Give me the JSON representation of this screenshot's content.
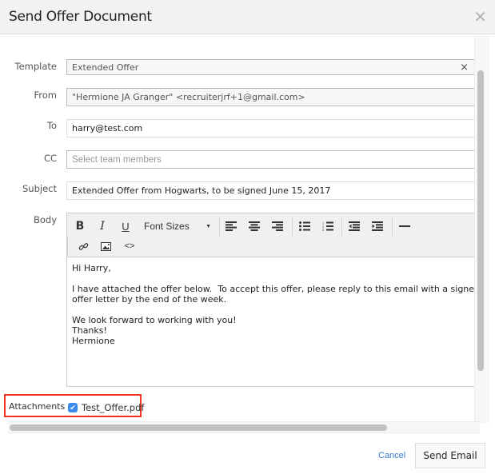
{
  "modal": {
    "title": "Send Offer Document",
    "close_icon": "close-icon"
  },
  "form": {
    "template": {
      "label": "Template",
      "value": "Extended Offer",
      "clear_icon": "×"
    },
    "from": {
      "label": "From",
      "value": "\"Hermione JA Granger\" <recruiterjrf+1@gmail.com>"
    },
    "to": {
      "label": "To",
      "value": "harry@test.com"
    },
    "cc": {
      "label": "CC",
      "placeholder": "Select team members"
    },
    "subject": {
      "label": "Subject",
      "value": "Extended Offer from Hogwarts, to be signed June 15, 2017"
    },
    "body": {
      "label": "Body",
      "toolbar": {
        "bold": "B",
        "italic": "I",
        "underline": "U",
        "font_sizes": "Font Sizes",
        "icons": [
          "align-left-icon",
          "align-center-icon",
          "align-right-icon",
          "bullet-list-icon",
          "numbered-list-icon",
          "outdent-icon",
          "indent-icon",
          "horizontal-rule-icon",
          "link-icon",
          "image-icon",
          "code-icon"
        ]
      },
      "content": "Hi Harry,\n\nI have attached the offer below.  To accept this offer, please reply to this email with a signed copy of the\noffer letter by the end of the week.\n\nWe look forward to working with you!\nThanks!\nHermione"
    },
    "attachments": {
      "label": "Attachments",
      "file": "Test_Offer.pdf",
      "checked": true
    }
  },
  "footer": {
    "cancel_label": "Cancel",
    "send_label": "Send Email"
  },
  "colors": {
    "highlight_box": "#ee3320",
    "checkbox": "#3b8ced",
    "link": "#3a7bc8"
  }
}
